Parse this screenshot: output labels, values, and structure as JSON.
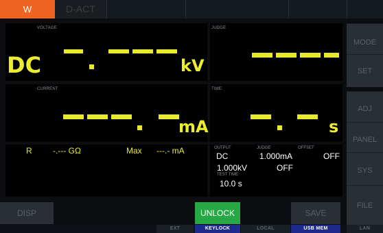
{
  "topbar": {
    "mode_w": "W",
    "mode_test": "D-ACT"
  },
  "voltage": {
    "label": "VOLTAGE",
    "prefix": "DC",
    "unit": "kV"
  },
  "judge_panel": {
    "label": "JUDGE"
  },
  "current": {
    "label": "CURRENT",
    "unit": "mA"
  },
  "time_panel": {
    "label": "TIME",
    "unit": "s"
  },
  "info_line": {
    "r_label": "R",
    "r_value": "-.--- GΩ",
    "max_label": "Max",
    "max_value": "---.- mA"
  },
  "settings": {
    "output_label": "OUTPUT",
    "output_mode": "DC",
    "output_voltage": "1.000kV",
    "judge_label": "JUDGE",
    "judge_current": "1.000mA",
    "judge_state": "OFF",
    "offset_label": "OFFSET",
    "offset_state": "OFF",
    "test_time_label": "TEST TIME",
    "test_time_value": "10.0 s"
  },
  "menu": [
    "MODE",
    "SET",
    "ADJ",
    "PANEL",
    "SYS",
    "FILE"
  ],
  "buttons": {
    "disp": "DISP",
    "unlock": "UNLOCK",
    "save": "SAVE"
  },
  "footer": {
    "ext": "EXT",
    "keylock": "KEYLOCK",
    "local": "LOCAL",
    "usb": "USB MEM",
    "lan": "LAN"
  },
  "colors": {
    "accent_orange": "#f06422",
    "segment_yellow": "#e9ea2c",
    "unlock_green": "#27a844",
    "status_blue": "#1e2a8c"
  }
}
